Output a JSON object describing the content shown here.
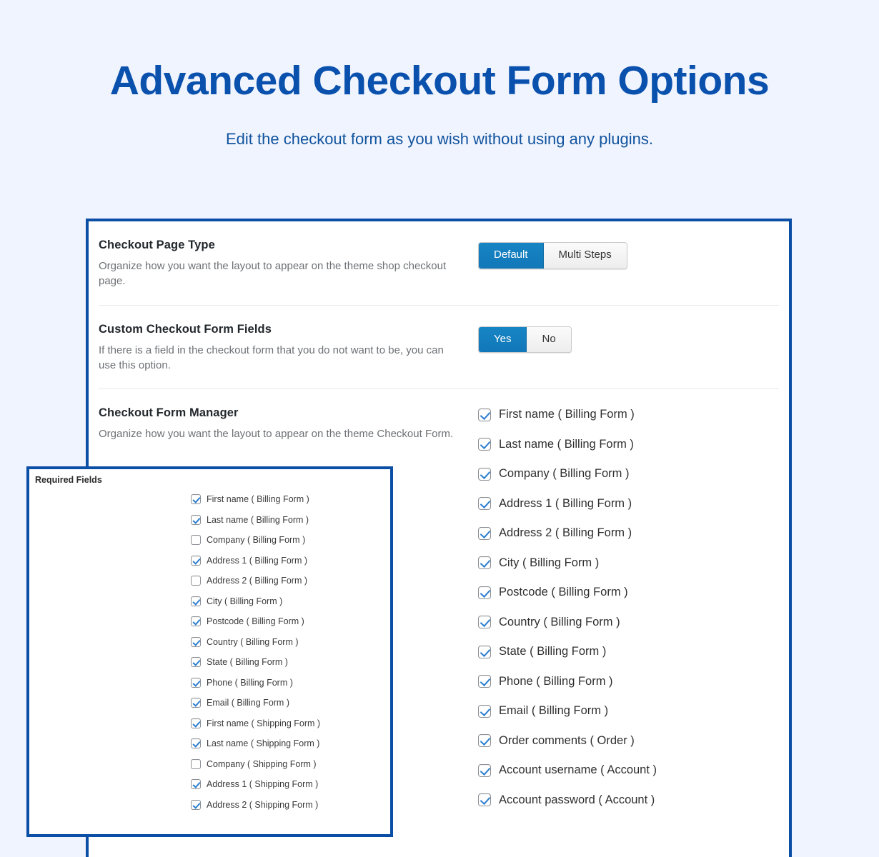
{
  "header": {
    "title": "Advanced Checkout Form Options",
    "subtitle": "Edit the checkout form as you wish without using any plugins."
  },
  "colors": {
    "page_background": "#f0f4fe",
    "brand_blue": "#0a51ae",
    "card_border": "#0b4ea6",
    "toggle_active": "#1177b8",
    "checkbox_check": "#2b7ed0",
    "heading_text": "#23282d",
    "description_text": "#6d7175"
  },
  "sections": [
    {
      "title": "Checkout Page Type",
      "description": "Organize how you want the layout to appear on the theme shop checkout page.",
      "control": "segmented-toggle",
      "options": [
        {
          "label": "Default",
          "active": true
        },
        {
          "label": "Multi Steps",
          "active": false
        }
      ]
    },
    {
      "title": "Custom Checkout Form Fields",
      "description": "If there is a field in the checkout form that you do not want to be, you can use this option.",
      "control": "segmented-toggle",
      "options": [
        {
          "label": "Yes",
          "active": true
        },
        {
          "label": "No",
          "active": false
        }
      ]
    },
    {
      "title": "Checkout Form Manager",
      "description": "Organize how you want the layout to appear on the theme Checkout Form.",
      "control": "checkbox-list"
    }
  ],
  "form_manager_fields": [
    {
      "label": "First name ( Billing Form )",
      "checked": true
    },
    {
      "label": "Last name ( Billing Form )",
      "checked": true
    },
    {
      "label": "Company ( Billing Form )",
      "checked": true
    },
    {
      "label": "Address 1 ( Billing Form )",
      "checked": true
    },
    {
      "label": "Address 2 ( Billing Form )",
      "checked": true
    },
    {
      "label": "City ( Billing Form )",
      "checked": true
    },
    {
      "label": "Postcode ( Billing Form )",
      "checked": true
    },
    {
      "label": "Country ( Billing Form )",
      "checked": true
    },
    {
      "label": "State ( Billing Form )",
      "checked": true
    },
    {
      "label": "Phone ( Billing Form )",
      "checked": true
    },
    {
      "label": "Email ( Billing Form )",
      "checked": true
    },
    {
      "label": "Order comments ( Order )",
      "checked": true
    },
    {
      "label": "Account username ( Account )",
      "checked": true
    },
    {
      "label": "Account password ( Account )",
      "checked": true
    }
  ],
  "overlay": {
    "title": "Required Fields",
    "fields": [
      {
        "label": "First name ( Billing Form )",
        "checked": true
      },
      {
        "label": "Last name ( Billing Form )",
        "checked": true
      },
      {
        "label": "Company ( Billing Form )",
        "checked": false
      },
      {
        "label": "Address 1 ( Billing Form )",
        "checked": true
      },
      {
        "label": "Address 2 ( Billing Form )",
        "checked": false
      },
      {
        "label": "City ( Billing Form )",
        "checked": true
      },
      {
        "label": "Postcode ( Billing Form )",
        "checked": true
      },
      {
        "label": "Country ( Billing Form )",
        "checked": true
      },
      {
        "label": "State ( Billing Form )",
        "checked": true
      },
      {
        "label": "Phone ( Billing Form )",
        "checked": true
      },
      {
        "label": "Email ( Billing Form )",
        "checked": true
      },
      {
        "label": "First name ( Shipping Form )",
        "checked": true
      },
      {
        "label": "Last name ( Shipping Form )",
        "checked": true
      },
      {
        "label": "Company ( Shipping Form )",
        "checked": false
      },
      {
        "label": "Address 1 ( Shipping Form )",
        "checked": true
      },
      {
        "label": "Address 2 ( Shipping Form )",
        "checked": true
      }
    ]
  }
}
